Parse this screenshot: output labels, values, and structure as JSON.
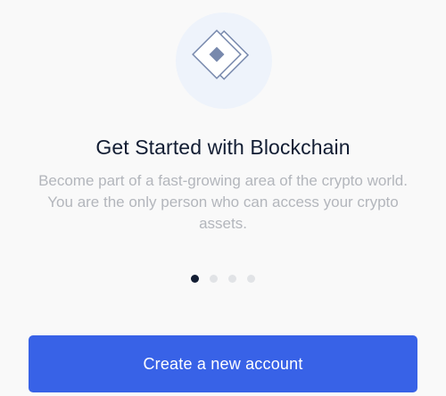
{
  "hero": {
    "icon": "layered-diamond-icon",
    "icon_background": "#eef3fb",
    "icon_color": "#7889ad"
  },
  "onboarding": {
    "title": "Get Started with Blockchain",
    "subtitle": "Become part of a fast-growing area of the crypto world. You are the only person who can access your crypto assets.",
    "page_count": 4,
    "current_page": 1
  },
  "actions": {
    "create_account_label": "Create a new account"
  },
  "colors": {
    "title": "#121d33",
    "subtitle": "#b3b6bc",
    "dot_active": "#121d33",
    "dot_inactive": "#e1e3e6",
    "primary_button": "#3862e7",
    "background": "#f9f9f9"
  }
}
